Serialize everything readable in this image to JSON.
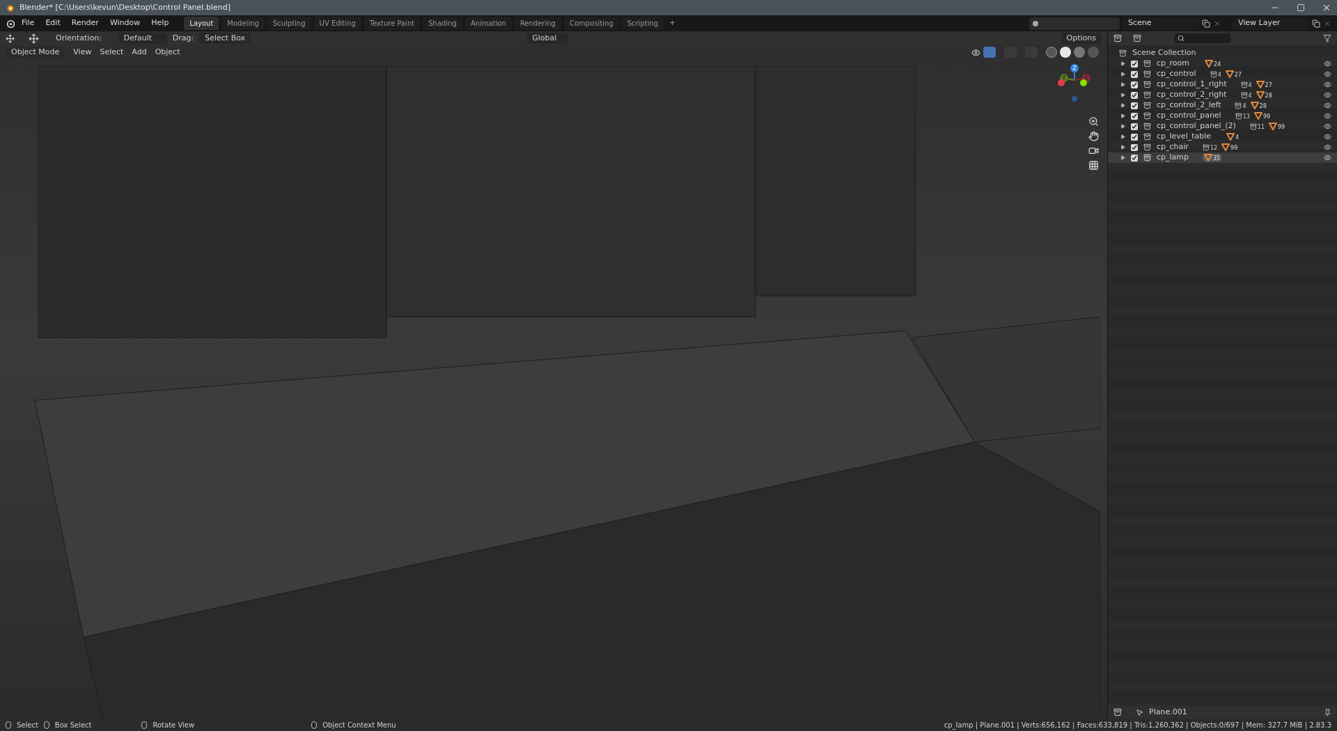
{
  "window": {
    "title": "Blender* [C:\\Users\\kevun\\Desktop\\Control Panel.blend]"
  },
  "menu": [
    "File",
    "Edit",
    "Render",
    "Window",
    "Help"
  ],
  "workspaces": [
    {
      "label": "Layout",
      "selected": true
    },
    {
      "label": "Modeling",
      "selected": false
    },
    {
      "label": "Sculpting",
      "selected": false
    },
    {
      "label": "UV Editing",
      "selected": false
    },
    {
      "label": "Texture Paint",
      "selected": false
    },
    {
      "label": "Shading",
      "selected": false
    },
    {
      "label": "Animation",
      "selected": false
    },
    {
      "label": "Rendering",
      "selected": false
    },
    {
      "label": "Compositing",
      "selected": false
    },
    {
      "label": "Scripting",
      "selected": false
    }
  ],
  "add_workspace": "+",
  "scene": {
    "name": "Scene",
    "view_layer": "View Layer"
  },
  "tool_header": {
    "orientation_label": "Orientation:",
    "orientation": "Default",
    "drag_label": "Drag:",
    "drag": "Select Box",
    "transform_orientation": "Global",
    "options": "Options"
  },
  "viewport_header": {
    "mode": "Object Mode",
    "menus": [
      "View",
      "Select",
      "Add",
      "Object"
    ]
  },
  "gizmo": {
    "axes": [
      "Z",
      "Y",
      "X"
    ]
  },
  "outliner": {
    "root": "Scene Collection",
    "items": [
      {
        "name": "cp_room",
        "checked": true,
        "selected": false,
        "mesh_count": "24"
      },
      {
        "name": "cp_control",
        "checked": true,
        "selected": false,
        "collection_count": "4",
        "mesh_count": "27"
      },
      {
        "name": "cp_control_1_right",
        "checked": true,
        "selected": false,
        "collection_count": "4",
        "mesh_count": "27"
      },
      {
        "name": "cp_control_2_right",
        "checked": true,
        "selected": false,
        "collection_count": "4",
        "mesh_count": "28"
      },
      {
        "name": "cp_control_2_left",
        "checked": true,
        "selected": false,
        "collection_count": "4",
        "mesh_count": "28"
      },
      {
        "name": "cp_control_panel",
        "checked": true,
        "selected": false,
        "collection_count": "13",
        "mesh_count": "99"
      },
      {
        "name": "cp_control_panel_(2)",
        "checked": true,
        "selected": false,
        "collection_count": "11",
        "mesh_count": "99"
      },
      {
        "name": "cp_level_table",
        "checked": true,
        "selected": false,
        "mesh_count": "4"
      },
      {
        "name": "cp_chair",
        "checked": true,
        "selected": false,
        "collection_count": "12",
        "mesh_count": "99"
      },
      {
        "name": "cp_lamp",
        "checked": true,
        "selected": true,
        "mesh_count": "35"
      }
    ]
  },
  "properties": {
    "object": "Plane.001"
  },
  "status_bar": {
    "hints": [
      "Select",
      "Box Select",
      "Rotate View",
      "Object Context Menu"
    ],
    "stats": "cp_lamp | Plane.001 | Verts:656,162 | Faces:633,819 | Tris:1,260,362 | Objects:0/697 | Mem: 327.7 MiB | 2.83.3"
  }
}
